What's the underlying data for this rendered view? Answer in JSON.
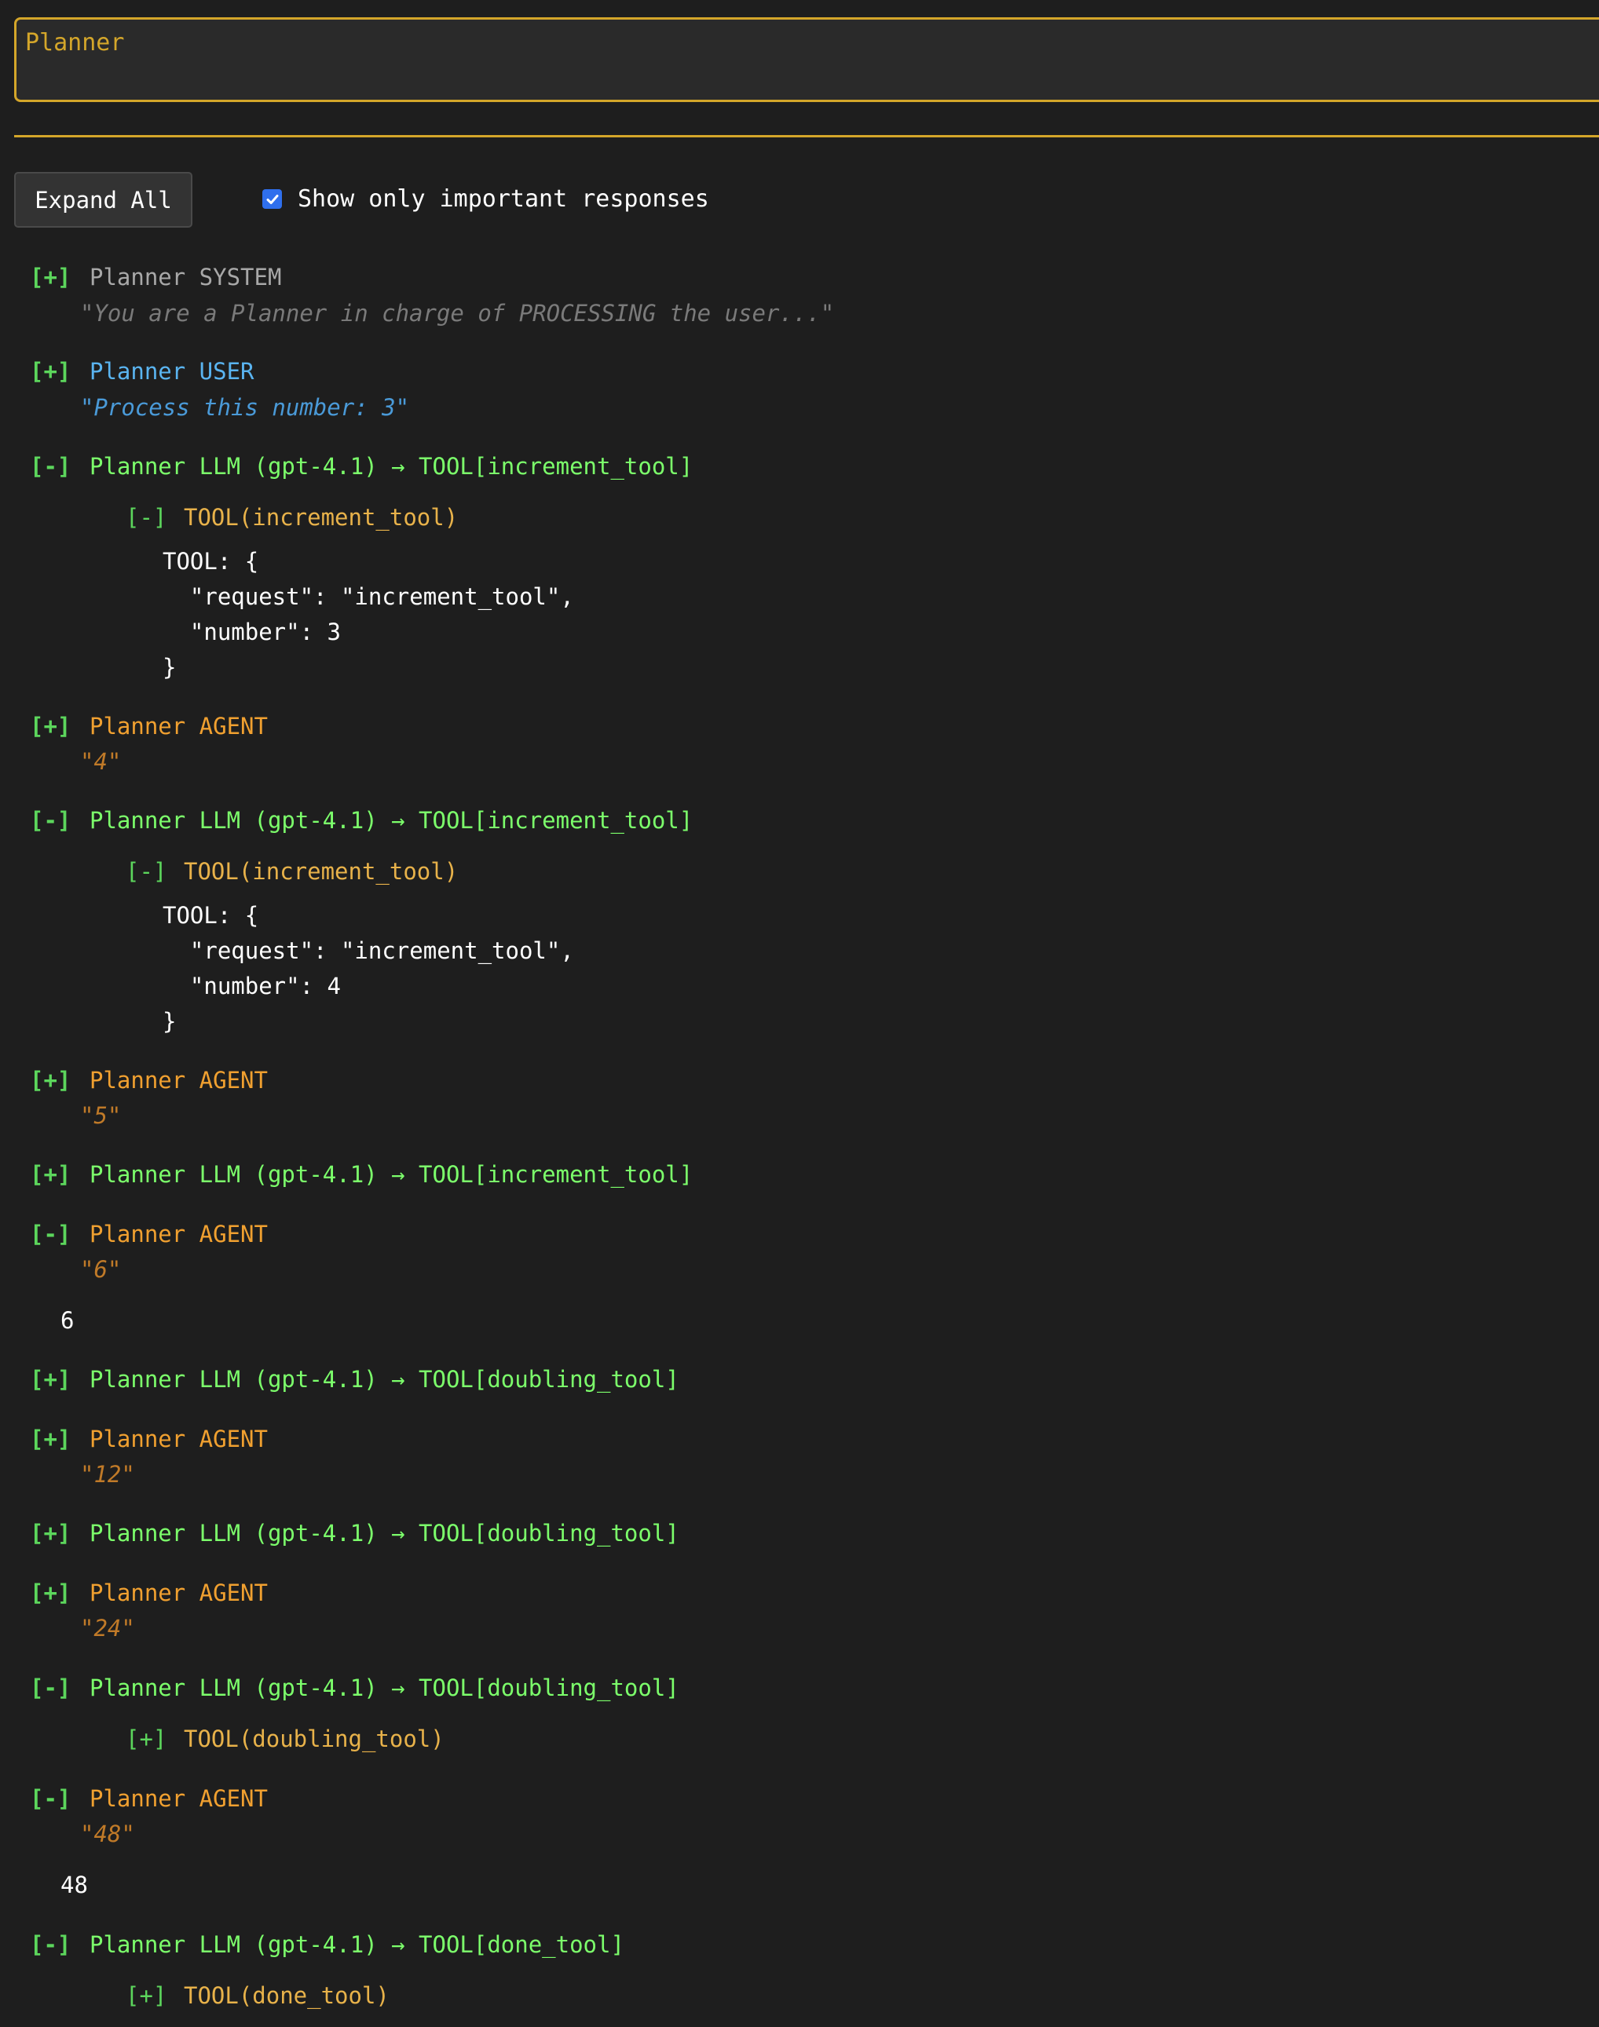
{
  "header": {
    "title": "Planner"
  },
  "controls": {
    "expand_all": "Expand All",
    "filter_label": "Show only important responses",
    "filter_checked": true
  },
  "entries": [
    {
      "toggle": "[+]",
      "label": "Planner SYSTEM",
      "quote": "\"You are a Planner in charge of PROCESSING the user...\""
    },
    {
      "toggle": "[+]",
      "label": "Planner USER",
      "quote": "\"Process this number: 3\""
    },
    {
      "toggle": "[-]",
      "label": "Planner LLM (gpt-4.1) → TOOL[increment_tool]",
      "tool_toggle": "[-]",
      "tool_label": "TOOL(increment_tool)",
      "code": [
        "TOOL: {",
        "  \"request\": \"increment_tool\",",
        "  \"number\": 3",
        "}"
      ]
    },
    {
      "toggle": "[+]",
      "label": "Planner AGENT",
      "quote": "\"4\""
    },
    {
      "toggle": "[-]",
      "label": "Planner LLM (gpt-4.1) → TOOL[increment_tool]",
      "tool_toggle": "[-]",
      "tool_label": "TOOL(increment_tool)",
      "code": [
        "TOOL: {",
        "  \"request\": \"increment_tool\",",
        "  \"number\": 4",
        "}"
      ]
    },
    {
      "toggle": "[+]",
      "label": "Planner AGENT",
      "quote": "\"5\""
    },
    {
      "toggle": "[+]",
      "label": "Planner LLM (gpt-4.1) → TOOL[increment_tool]"
    },
    {
      "toggle": "[-]",
      "label": "Planner AGENT",
      "quote": "\"6\"",
      "content": "6"
    },
    {
      "toggle": "[+]",
      "label": "Planner LLM (gpt-4.1) → TOOL[doubling_tool]"
    },
    {
      "toggle": "[+]",
      "label": "Planner AGENT",
      "quote": "\"12\""
    },
    {
      "toggle": "[+]",
      "label": "Planner LLM (gpt-4.1) → TOOL[doubling_tool]"
    },
    {
      "toggle": "[+]",
      "label": "Planner AGENT",
      "quote": "\"24\""
    },
    {
      "toggle": "[-]",
      "label": "Planner LLM (gpt-4.1) → TOOL[doubling_tool]",
      "tool_toggle": "[+]",
      "tool_label": "TOOL(doubling_tool)"
    },
    {
      "toggle": "[-]",
      "label": "Planner AGENT",
      "quote": "\"48\"",
      "content": "48"
    },
    {
      "toggle": "[-]",
      "label": "Planner LLM (gpt-4.1) → TOOL[done_tool]",
      "tool_toggle": "[+]",
      "tool_label": "TOOL(done_tool)"
    }
  ]
}
